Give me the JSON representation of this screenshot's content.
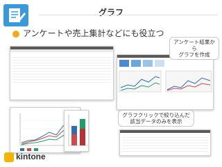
{
  "header": {
    "title": "グラフ"
  },
  "headline": "アンケートや売上集計などにも役立つ",
  "callouts": {
    "survey": [
      "アンケート結果から",
      "グラフを作成"
    ],
    "filter": [
      "グラフクリックで絞り込んだ",
      "該当データのみを表示"
    ]
  },
  "brand": {
    "name": "kintone"
  },
  "colors": {
    "accent": "#f5a81c",
    "icon": "#3a9ad9",
    "brand": "#f5b400"
  },
  "icons": {
    "edit": "document-edit-icon",
    "bullet": "bullet-icon",
    "logo": "kintone-logo-icon"
  }
}
